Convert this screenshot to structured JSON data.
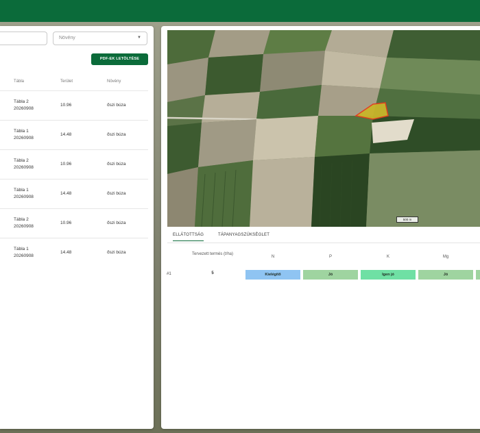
{
  "colors": {
    "brand": "#0b6b3a",
    "status_blue": "#8fc4f2",
    "status_green": "#9fd4a0",
    "status_mint": "#6fe0a4",
    "field_outline": "#e53b1f",
    "field_fill": "#c8b52a"
  },
  "filters": {
    "search_value": "",
    "crop_placeholder": "Növény"
  },
  "actions": {
    "pdf_download": "PDF-EK LETÖLTÉSE"
  },
  "table": {
    "headers": [
      "Tábla",
      "Terület",
      "Növény"
    ],
    "rows": [
      {
        "tabla": "Tábla 2",
        "date": "20260908",
        "terulet": "10.96",
        "noveny": "őszi búza"
      },
      {
        "tabla": "Tábla 1",
        "date": "20260908",
        "terulet": "14.48",
        "noveny": "őszi búza"
      },
      {
        "tabla": "Tábla 2",
        "date": "20260908",
        "terulet": "10.96",
        "noveny": "őszi búza"
      },
      {
        "tabla": "Tábla 1",
        "date": "20260908",
        "terulet": "14.48",
        "noveny": "őszi búza"
      },
      {
        "tabla": "Tábla 2",
        "date": "20260908",
        "terulet": "10.96",
        "noveny": "őszi búza"
      },
      {
        "tabla": "Tábla 1",
        "date": "20260908",
        "terulet": "14.48",
        "noveny": "őszi búza"
      }
    ]
  },
  "map": {
    "scale_label": "500 m"
  },
  "tabs": [
    {
      "label": "ELLÁTOTTSÁG",
      "active": true
    },
    {
      "label": "TÁPANYAGSZÜKSÉGLET",
      "active": false
    }
  ],
  "results": {
    "headers": {
      "yield": "Tervezett termés (t/ha)",
      "n": "N",
      "p": "P",
      "k": "K",
      "mg": "Mg"
    },
    "row": {
      "index": "#1",
      "yield": "5",
      "n": "Kielégítő",
      "p": "Jó",
      "k": "Igen jó",
      "mg": "Jó"
    }
  }
}
